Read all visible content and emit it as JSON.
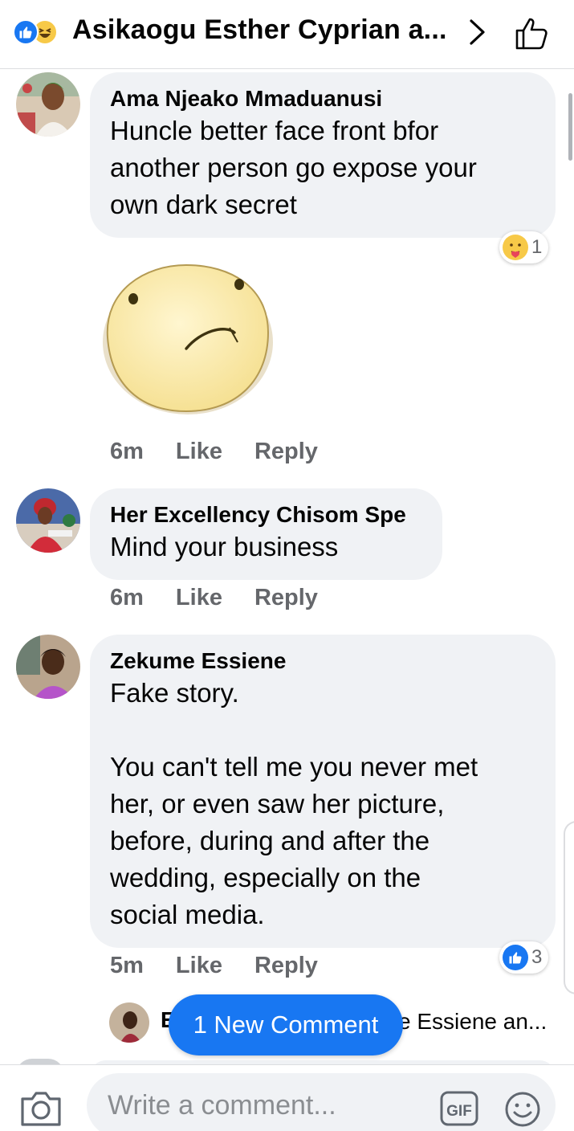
{
  "header": {
    "title": "Asikaogu Esther Cyprian a...",
    "reaction_icons": [
      "like-icon",
      "haha-icon"
    ],
    "accent": "#1877f2"
  },
  "comments": [
    {
      "author": "Ama Njeako Mmaduanusi",
      "text": "Huncle better face front bfor\nanother person go expose your\nown dark secret",
      "reaction": {
        "icon": "care-icon",
        "count": "1"
      },
      "sticker": "confused-face-sticker",
      "time": "6m",
      "like_label": "Like",
      "reply_label": "Reply"
    },
    {
      "author": "Her Excellency Chisom Spe",
      "text": "Mind your business",
      "time": "6m",
      "like_label": "Like",
      "reply_label": "Reply"
    },
    {
      "author": "Zekume Essiene",
      "text": "Fake story.\n\nYou can't tell me you never met\nher, or even saw her picture,\nbefore, during and after the\nwedding, especially on the\nsocial media.",
      "reaction": {
        "icon": "like-icon",
        "count": "3"
      },
      "time": "5m",
      "like_label": "Like",
      "reply_label": "Reply"
    }
  ],
  "reply_preview": {
    "initial": "E",
    "tail_text": "e Essiene an..."
  },
  "new_comment_label": "1 New Comment",
  "composer": {
    "placeholder": "Write a comment...",
    "gif_label": "GIF"
  }
}
